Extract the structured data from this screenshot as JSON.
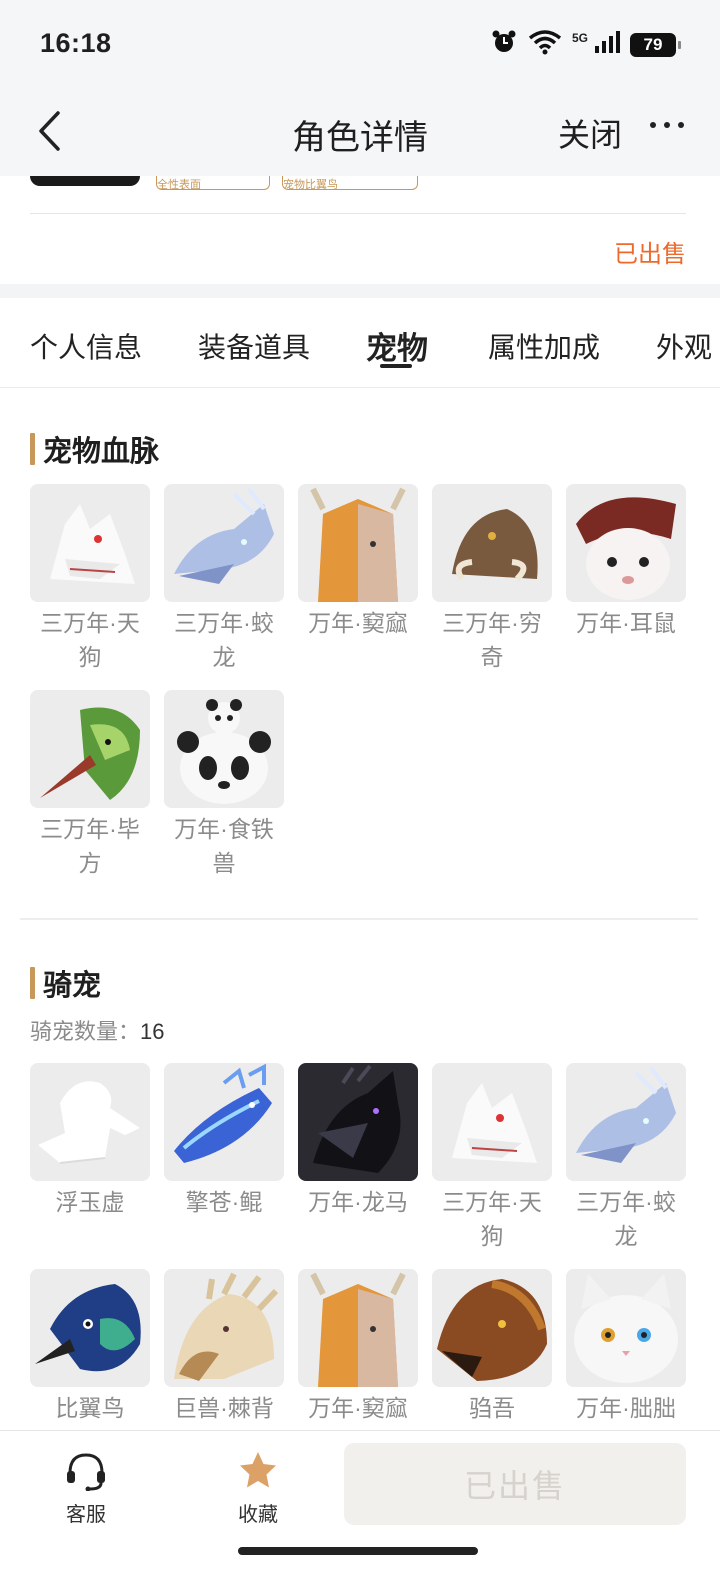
{
  "status_bar": {
    "time": "16:18",
    "network": "5G",
    "battery": "79"
  },
  "nav": {
    "title": "角色详情",
    "close_label": "关闭"
  },
  "top_card": {
    "tag_1": "全性表面",
    "tag_2": "宠物比翼鸟",
    "sale_status": "已出售"
  },
  "tabs": [
    {
      "label": "个人信息"
    },
    {
      "label": "装备道具"
    },
    {
      "label": "宠物"
    },
    {
      "label": "属性加成"
    },
    {
      "label": "外观"
    }
  ],
  "active_tab": "宠物",
  "pet_bloodline": {
    "title": "宠物血脉",
    "items": [
      {
        "name": "三万年·天狗",
        "icon": "white-wolf-icon"
      },
      {
        "name": "三万年·蛟龙",
        "icon": "blue-dragon-icon"
      },
      {
        "name": "万年·窫窳",
        "icon": "horned-beast-face-icon"
      },
      {
        "name": "三万年·穷奇",
        "icon": "brown-tusked-beast-icon"
      },
      {
        "name": "万年·耳鼠",
        "icon": "white-red-mouse-icon"
      },
      {
        "name": "三万年·毕方",
        "icon": "green-crane-icon"
      },
      {
        "name": "万年·食铁兽",
        "icon": "panda-icon"
      }
    ]
  },
  "mounts": {
    "title": "骑宠",
    "count_label": "骑宠数量：",
    "count": "16",
    "items": [
      {
        "name": "浮玉虚",
        "icon": "white-cloud-beast-icon"
      },
      {
        "name": "擎苍·鲲",
        "icon": "blue-whale-dragon-icon"
      },
      {
        "name": "万年·龙马",
        "icon": "black-dragon-horse-icon"
      },
      {
        "name": "三万年·天狗",
        "icon": "white-wolf-icon"
      },
      {
        "name": "三万年·蛟龙",
        "icon": "blue-dragon-icon"
      },
      {
        "name": "比翼鸟",
        "icon": "blue-bird-icon"
      },
      {
        "name": "巨兽·棘背",
        "icon": "bone-beast-icon"
      },
      {
        "name": "万年·窫窳",
        "icon": "horned-beast-face-icon"
      },
      {
        "name": "驺吾",
        "icon": "tiger-beast-icon"
      },
      {
        "name": "万年·朏朏",
        "icon": "white-cat-icon"
      }
    ]
  },
  "bottom_bar": {
    "service_label": "客服",
    "favorite_label": "收藏",
    "sold_button_label": "已出售"
  },
  "colors": {
    "accent_gold": "#c7985a",
    "sold_orange": "#ee6a2c"
  }
}
